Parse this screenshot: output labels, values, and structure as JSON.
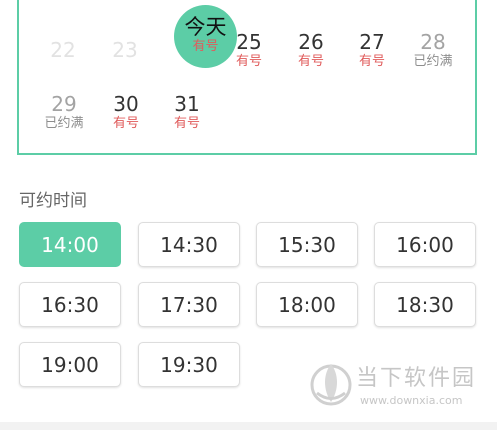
{
  "calendar": {
    "row1": [
      {
        "num": "22",
        "status": "",
        "state": "past"
      },
      {
        "num": "23",
        "status": "",
        "state": "past"
      },
      {
        "num": "今天",
        "status": "有号",
        "state": "today"
      },
      {
        "num": "25",
        "status": "有号",
        "state": "avail"
      },
      {
        "num": "26",
        "status": "有号",
        "state": "avail"
      },
      {
        "num": "27",
        "status": "有号",
        "state": "avail"
      },
      {
        "num": "28",
        "status": "已约满",
        "state": "full"
      }
    ],
    "row2": [
      {
        "num": "29",
        "status": "已约满",
        "state": "full"
      },
      {
        "num": "30",
        "status": "有号",
        "state": "avail"
      },
      {
        "num": "31",
        "status": "有号",
        "state": "avail"
      }
    ]
  },
  "times": {
    "title": "可约时间",
    "slots": [
      "14:00",
      "14:30",
      "15:30",
      "16:00",
      "16:30",
      "17:30",
      "18:00",
      "18:30",
      "19:00",
      "19:30"
    ],
    "selected": "14:00"
  },
  "watermark": {
    "title": "当下软件园",
    "url": "www.downxia.com"
  },
  "colors": {
    "accent": "#5ccda6",
    "available": "#e05c5c",
    "full": "#8e8e8e"
  }
}
